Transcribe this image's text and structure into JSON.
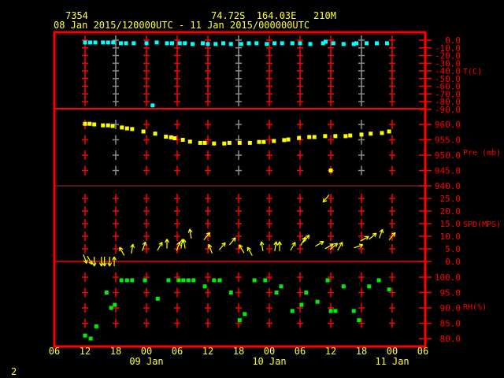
{
  "header": {
    "station_id": "7354",
    "location": "74.72S  164.03E   210M",
    "period": "08 Jan 2015/120000UTC - 11 Jan 2015/000000UTC"
  },
  "footer": {
    "page_number": "2"
  },
  "colors": {
    "frame": "#ff0000",
    "text": "#ffff33",
    "temperature": "#00ffff",
    "pressure": "#ffff00",
    "wind": "#ffff00",
    "rh": "#00ee00"
  },
  "chart_data": {
    "type": "scatter",
    "time_unit": "hours since 08 Jan 2015 12UTC",
    "x_range": [
      -6,
      66
    ],
    "x_ticks": [
      {
        "h": -6,
        "label": "06"
      },
      {
        "h": 0,
        "label": "12"
      },
      {
        "h": 6,
        "label": "18"
      },
      {
        "h": 12,
        "label": "00"
      },
      {
        "h": 18,
        "label": "06"
      },
      {
        "h": 24,
        "label": "12"
      },
      {
        "h": 30,
        "label": "18"
      },
      {
        "h": 36,
        "label": "00"
      },
      {
        "h": 42,
        "label": "06"
      },
      {
        "h": 48,
        "label": "12"
      },
      {
        "h": 54,
        "label": "18"
      },
      {
        "h": 60,
        "label": "00"
      },
      {
        "h": 66,
        "label": "06"
      }
    ],
    "date_labels": [
      {
        "h": 12,
        "label": "09 Jan"
      },
      {
        "h": 36,
        "label": "10 Jan"
      },
      {
        "h": 60,
        "label": "11 Jan"
      }
    ],
    "panels": [
      {
        "name": "temperature",
        "label": "T(C)",
        "ylim": [
          -90,
          0
        ],
        "ticks": [
          "0.0",
          "-10.0",
          "-20.0",
          "-30.0",
          "-40.0",
          "-50.0",
          "-60.0",
          "-70.0",
          "-80.0",
          "-90.0"
        ],
        "points": [
          [
            0,
            -3
          ],
          [
            1,
            -3
          ],
          [
            2,
            -3
          ],
          [
            3.5,
            -3
          ],
          [
            4.5,
            -3
          ],
          [
            5.5,
            -3
          ],
          [
            7,
            -4
          ],
          [
            8,
            -4
          ],
          [
            9.5,
            -4
          ],
          [
            12,
            -4
          ],
          [
            13.2,
            -85
          ],
          [
            14,
            -3
          ],
          [
            16,
            -4
          ],
          [
            17,
            -4
          ],
          [
            18.5,
            -4
          ],
          [
            19.5,
            -4
          ],
          [
            21,
            -5
          ],
          [
            23,
            -4
          ],
          [
            24,
            -5
          ],
          [
            25.5,
            -5
          ],
          [
            27,
            -4
          ],
          [
            28.5,
            -5
          ],
          [
            30.5,
            -5
          ],
          [
            32,
            -4
          ],
          [
            33.5,
            -4
          ],
          [
            35.5,
            -5
          ],
          [
            37,
            -4
          ],
          [
            38.5,
            -4
          ],
          [
            40.5,
            -4
          ],
          [
            42,
            -4
          ],
          [
            44,
            -5
          ],
          [
            46.5,
            -4
          ],
          [
            47,
            -2
          ],
          [
            48.5,
            -4
          ],
          [
            50.5,
            -5
          ],
          [
            52.5,
            -5
          ],
          [
            53,
            -4
          ],
          [
            55,
            -4
          ],
          [
            57,
            -4
          ],
          [
            59,
            -4
          ]
        ]
      },
      {
        "name": "pressure",
        "label": "Pre (mb)",
        "ylim": [
          940,
          965
        ],
        "ticks": [
          "960.0",
          "955.0",
          "950.0",
          "945.0",
          "940.0"
        ],
        "points": [
          [
            0,
            960.2
          ],
          [
            0.9,
            960.2
          ],
          [
            1.8,
            960
          ],
          [
            3.5,
            959.7
          ],
          [
            4.5,
            959.7
          ],
          [
            5.4,
            959.5
          ],
          [
            7.2,
            959
          ],
          [
            8.2,
            958.7
          ],
          [
            9.2,
            958.5
          ],
          [
            11.4,
            957.7
          ],
          [
            13.7,
            957
          ],
          [
            15.8,
            956
          ],
          [
            16.8,
            955.8
          ],
          [
            17.5,
            955.5
          ],
          [
            19.1,
            955
          ],
          [
            20.5,
            954.4
          ],
          [
            22.5,
            954
          ],
          [
            23.4,
            954
          ],
          [
            25.2,
            953.8
          ],
          [
            27.2,
            953.8
          ],
          [
            28.2,
            954
          ],
          [
            30.2,
            954
          ],
          [
            32.2,
            954
          ],
          [
            34,
            954.3
          ],
          [
            34.9,
            954.3
          ],
          [
            36.9,
            954.6
          ],
          [
            38.9,
            954.9
          ],
          [
            39.7,
            955.1
          ],
          [
            41.8,
            955.6
          ],
          [
            43.8,
            955.9
          ],
          [
            44.8,
            955.9
          ],
          [
            46.9,
            956.2
          ],
          [
            48,
            945
          ],
          [
            48.9,
            956.2
          ],
          [
            50.9,
            956.2
          ],
          [
            51.8,
            956.4
          ],
          [
            54,
            956.7
          ],
          [
            55.8,
            957
          ],
          [
            58,
            957.2
          ],
          [
            59.4,
            957.7
          ]
        ]
      },
      {
        "name": "wind",
        "label": "SPD(MPS)",
        "ylim": [
          0,
          30
        ],
        "ticks": [
          "25.0",
          "20.0",
          "15.0",
          "10.0",
          "5.0",
          "0.0"
        ],
        "points_time_speed_dir": [
          [
            0,
            1,
            160
          ],
          [
            0.9,
            0.5,
            150
          ],
          [
            1.8,
            0,
            180
          ],
          [
            3.2,
            0,
            180
          ],
          [
            3.8,
            0,
            180
          ],
          [
            4.8,
            0,
            180
          ],
          [
            5.7,
            0,
            0
          ],
          [
            7.2,
            4,
            330
          ],
          [
            9.2,
            5,
            10
          ],
          [
            11.5,
            6,
            20
          ],
          [
            14.6,
            6,
            30
          ],
          [
            16,
            7,
            0
          ],
          [
            18.2,
            6,
            20
          ],
          [
            18.9,
            7,
            10
          ],
          [
            19.4,
            7,
            350
          ],
          [
            20.6,
            11,
            350
          ],
          [
            23.8,
            10,
            40
          ],
          [
            24.5,
            5,
            340
          ],
          [
            26.8,
            6,
            40
          ],
          [
            28.8,
            8,
            40
          ],
          [
            30.6,
            5,
            330
          ],
          [
            32.2,
            4,
            330
          ],
          [
            34.6,
            6,
            350
          ],
          [
            37.2,
            6,
            10
          ],
          [
            38,
            6,
            0
          ],
          [
            40.6,
            6,
            30
          ],
          [
            42.6,
            8,
            30
          ],
          [
            43.2,
            9,
            40
          ],
          [
            45.8,
            7,
            60
          ],
          [
            47.1,
            25,
            220
          ],
          [
            47.7,
            6,
            60
          ],
          [
            48.6,
            6,
            50
          ],
          [
            49.8,
            6,
            30
          ],
          [
            53.4,
            6,
            70
          ],
          [
            54.6,
            9,
            60
          ],
          [
            56.2,
            10,
            50
          ],
          [
            57.8,
            11,
            20
          ],
          [
            60,
            10,
            40
          ]
        ]
      },
      {
        "name": "rh",
        "label": "RH(%)",
        "ylim": [
          80,
          100
        ],
        "ticks": [
          "100.0",
          "95.0",
          "90.0",
          "85.0",
          "80.0"
        ],
        "points": [
          [
            0,
            81
          ],
          [
            1.1,
            80
          ],
          [
            2.2,
            84
          ],
          [
            4.2,
            95
          ],
          [
            5.1,
            90
          ],
          [
            5.8,
            91
          ],
          [
            7.1,
            99
          ],
          [
            8.2,
            99
          ],
          [
            9.2,
            99
          ],
          [
            11.7,
            99
          ],
          [
            14.2,
            93
          ],
          [
            16.3,
            99
          ],
          [
            18.3,
            99
          ],
          [
            19.2,
            99
          ],
          [
            20.2,
            99
          ],
          [
            21.2,
            99
          ],
          [
            23.4,
            97
          ],
          [
            25.2,
            99
          ],
          [
            26.3,
            99
          ],
          [
            28.5,
            95
          ],
          [
            30.2,
            86
          ],
          [
            31.2,
            88
          ],
          [
            33.1,
            99
          ],
          [
            35.2,
            99
          ],
          [
            37.4,
            95
          ],
          [
            38.3,
            97
          ],
          [
            40.5,
            89
          ],
          [
            42.3,
            91
          ],
          [
            43.2,
            95
          ],
          [
            45.4,
            92
          ],
          [
            47.4,
            99
          ],
          [
            48,
            89
          ],
          [
            48.9,
            89
          ],
          [
            50.5,
            97
          ],
          [
            52.5,
            89
          ],
          [
            53.5,
            86
          ],
          [
            55.5,
            97
          ],
          [
            57.4,
            99
          ],
          [
            59.4,
            96
          ]
        ]
      }
    ]
  }
}
